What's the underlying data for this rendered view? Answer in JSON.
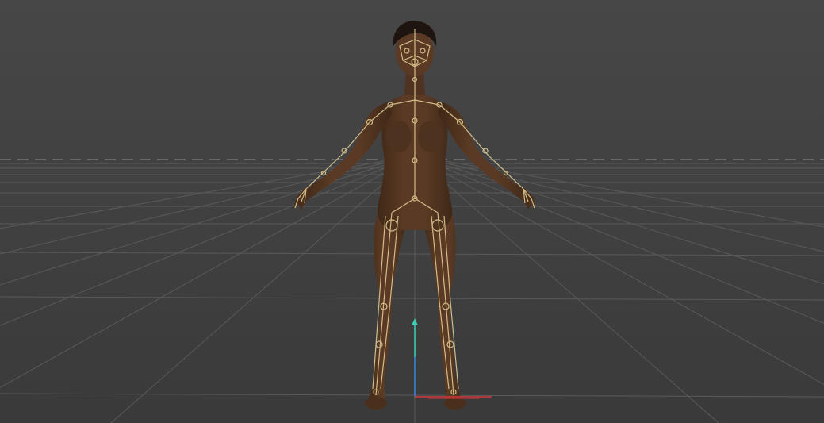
{
  "viewport": {
    "background_top": "#474747",
    "background_bottom": "#3a3a3a",
    "grid_color": "#5a5a5a",
    "horizon_color": "#8e8e8e"
  },
  "model": {
    "skin_color": "#5a3a24",
    "skin_shadow": "#3f2817",
    "hair_color": "#1f1510",
    "rig_color": "#e8d49a"
  },
  "axis_gizmo": {
    "y_color": "#3fd0ba",
    "z_color": "#3a6ec8",
    "x_color": "#d23a3a"
  }
}
